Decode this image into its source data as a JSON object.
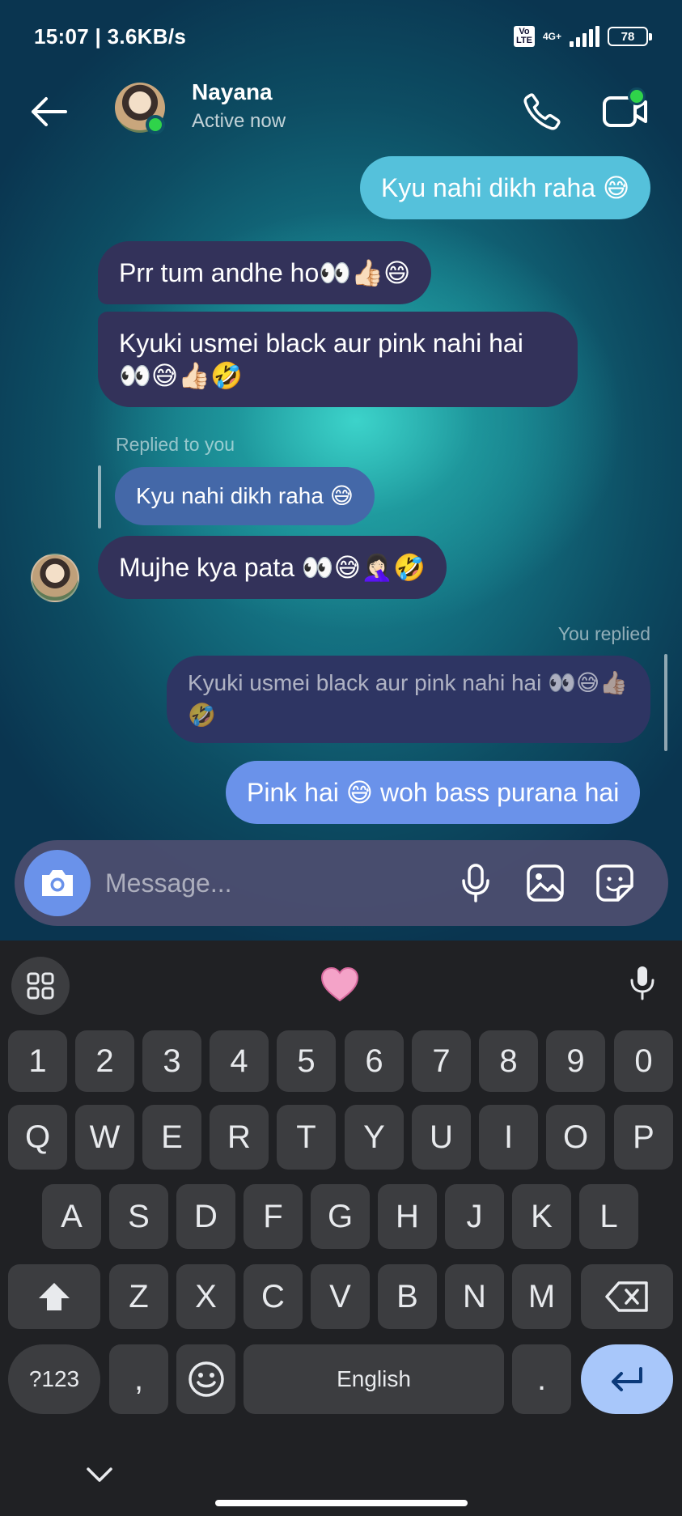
{
  "status_bar": {
    "time": "15:07 | 3.6KB/s",
    "volte": "Vo LTE",
    "network": "4G+",
    "battery": "78"
  },
  "header": {
    "contact_name": "Nayana",
    "contact_status": "Active now",
    "back_icon": "arrow-left-icon",
    "call_icon": "phone-icon",
    "video_icon": "video-camera-icon"
  },
  "messages": [
    {
      "from": "me",
      "text": "Kyu nahi dikh raha 😅"
    },
    {
      "from": "them",
      "text": "Prr tum andhe ho👀👍🏻😄"
    },
    {
      "from": "them",
      "text": "Kyuki usmei black aur pink nahi hai 👀😅👍🏻🤣"
    },
    {
      "from": "them",
      "reply_label": "Replied to you",
      "quoted": "Kyu nahi dikh raha 😅",
      "text": "Mujhe kya pata 👀😅🤦🏻‍♀️🤣"
    },
    {
      "from": "me",
      "reply_label": "You replied",
      "quoted": "Kyuki usmei black aur pink nahi hai 👀😅👍🏻🤣",
      "text": "Pink hai 😅 woh bass purana hai"
    }
  ],
  "composer": {
    "placeholder": "Message...",
    "camera_icon": "camera-icon",
    "mic_icon": "microphone-icon",
    "gallery_icon": "image-icon",
    "sticker_icon": "sticker-icon"
  },
  "keyboard": {
    "toolbar": {
      "apps_icon": "grid-icon",
      "emoji_suggestion": "🩷",
      "voice_icon": "microphone-icon"
    },
    "number_row": [
      "1",
      "2",
      "3",
      "4",
      "5",
      "6",
      "7",
      "8",
      "9",
      "0"
    ],
    "row1": [
      "Q",
      "W",
      "E",
      "R",
      "T",
      "Y",
      "U",
      "I",
      "O",
      "P"
    ],
    "row2": [
      "A",
      "S",
      "D",
      "F",
      "G",
      "H",
      "J",
      "K",
      "L"
    ],
    "row3": [
      "Z",
      "X",
      "C",
      "V",
      "B",
      "N",
      "M"
    ],
    "symbols_key": "?123",
    "comma_key": ",",
    "space_label": "English",
    "period_key": ".",
    "shift_icon": "shift-icon",
    "backspace_icon": "backspace-icon",
    "emoji_icon": "smiley-icon",
    "enter_icon": "enter-icon",
    "hide_icon": "chevron-down-icon"
  }
}
